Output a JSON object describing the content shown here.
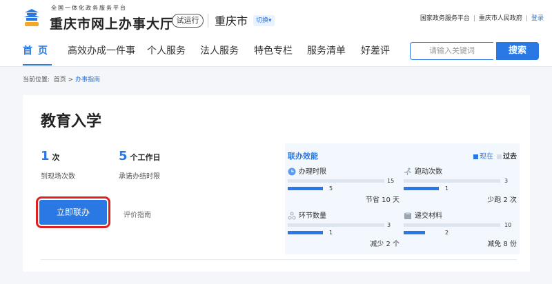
{
  "header": {
    "slogan": "全国一体化政务服务平台",
    "site_title": "重庆市网上办事大厅",
    "trial_label": "试运行",
    "city": "重庆市",
    "switch_label": "切换",
    "links": [
      "国家政务服务平台",
      "重庆市人民政府"
    ],
    "login": "登录"
  },
  "nav": {
    "items": [
      "首页",
      "高效办成一件事",
      "个人服务",
      "法人服务",
      "特色专栏",
      "服务清单",
      "好差评"
    ],
    "active_index": 0
  },
  "search": {
    "placeholder": "请输入关键词",
    "button": "搜索"
  },
  "breadcrumb": {
    "prefix": "当前位置:",
    "home": "首页",
    "sep": ">",
    "current": "办事指南"
  },
  "card": {
    "title": "教育入学",
    "stats": [
      {
        "value": "1",
        "unit": "次",
        "label": "到现场次数"
      },
      {
        "value": "5",
        "unit": "个工作日",
        "label": "承诺办结时限"
      }
    ],
    "action_button": "立即联办",
    "eval_link": "评价指南"
  },
  "panel": {
    "title": "联办效能",
    "legend": {
      "now": "现在",
      "past": "过去"
    },
    "colors": {
      "now": "#2a78e4",
      "past": "#dde5ef"
    },
    "metrics": [
      {
        "icon": "clock-icon",
        "label": "办理时限",
        "past": 15,
        "now": 5,
        "saving": "节省 10 天"
      },
      {
        "icon": "run-icon",
        "label": "跑动次数",
        "past": 3,
        "now": 1,
        "saving": "少跑 2 次"
      },
      {
        "icon": "node-icon",
        "label": "环节数量",
        "past": 3,
        "now": 1,
        "saving": "减少 2 个"
      },
      {
        "icon": "doc-icon",
        "label": "递交材料",
        "past": 10,
        "now": 2,
        "saving": "减免 8 份"
      }
    ]
  }
}
